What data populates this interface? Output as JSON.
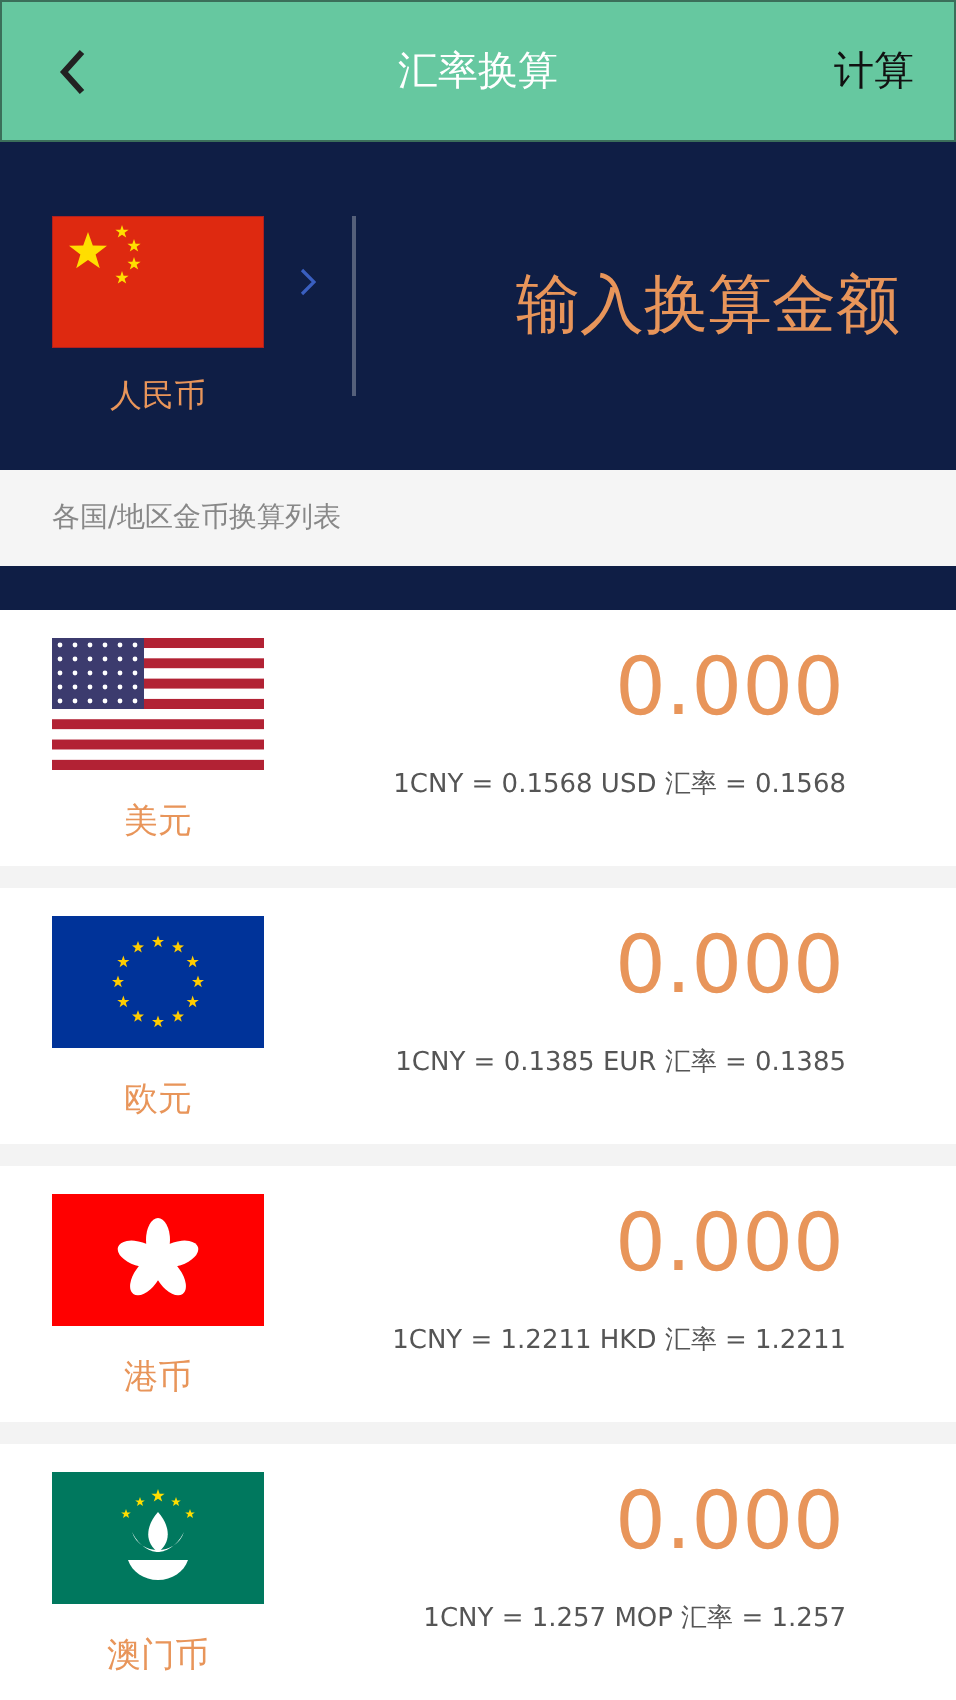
{
  "header": {
    "title": "汇率换算",
    "action": "计算"
  },
  "base": {
    "kind": "cn",
    "currency": "人民币",
    "prompt": "输入换算金额"
  },
  "section_label": "各国/地区金币换算列表",
  "currencies": [
    {
      "kind": "us",
      "name": "美元",
      "amount": "0.000",
      "rate": "1CNY = 0.1568 USD 汇率 = 0.1568"
    },
    {
      "kind": "eu",
      "name": "欧元",
      "amount": "0.000",
      "rate": "1CNY = 0.1385 EUR 汇率 = 0.1385"
    },
    {
      "kind": "hk",
      "name": "港币",
      "amount": "0.000",
      "rate": "1CNY = 1.2211 HKD 汇率 = 1.2211"
    },
    {
      "kind": "mo",
      "name": "澳门币",
      "amount": "0.000",
      "rate": "1CNY = 1.257 MOP 汇率 = 1.257"
    }
  ]
}
